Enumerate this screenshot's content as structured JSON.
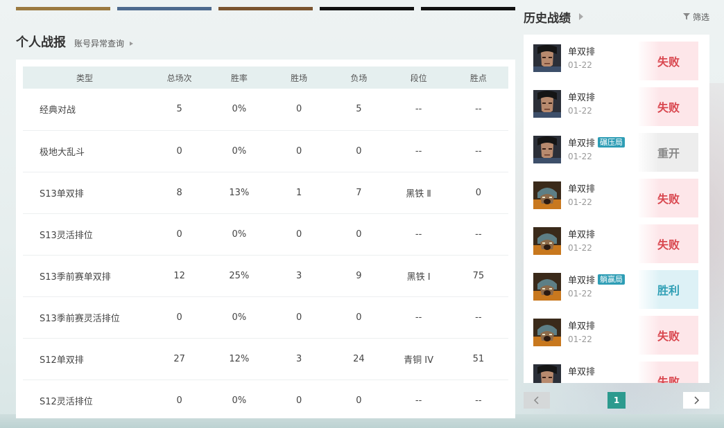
{
  "colors": {
    "strips": [
      "#9b7a40",
      "#4d6a8e",
      "#7a5430",
      "#111111",
      "#111111"
    ],
    "lose": "#d9474f",
    "win": "#2f9fb5",
    "remake": "#888888",
    "page_active": "#2c9a8e"
  },
  "left": {
    "title": "个人战报",
    "account_link": "账号异常查询"
  },
  "table": {
    "headers": {
      "type": "类型",
      "total": "总场次",
      "winrate": "胜率",
      "wins": "胜场",
      "losses": "负场",
      "rank": "段位",
      "lp": "胜点"
    },
    "rows": [
      {
        "type": "经典对战",
        "total": "5",
        "winrate": "0%",
        "wins": "0",
        "losses": "5",
        "rank": "--",
        "lp": "--"
      },
      {
        "type": "极地大乱斗",
        "total": "0",
        "winrate": "0%",
        "wins": "0",
        "losses": "0",
        "rank": "--",
        "lp": "--"
      },
      {
        "type": "S13单双排",
        "total": "8",
        "winrate": "13%",
        "wins": "1",
        "losses": "7",
        "rank": "黑铁 Ⅱ",
        "lp": "0"
      },
      {
        "type": "S13灵活排位",
        "total": "0",
        "winrate": "0%",
        "wins": "0",
        "losses": "0",
        "rank": "--",
        "lp": "--"
      },
      {
        "type": "S13季前赛单双排",
        "total": "12",
        "winrate": "25%",
        "wins": "3",
        "losses": "9",
        "rank": "黑铁 Ⅰ",
        "lp": "75"
      },
      {
        "type": "S13季前赛灵活排位",
        "total": "0",
        "winrate": "0%",
        "wins": "0",
        "losses": "0",
        "rank": "--",
        "lp": "--"
      },
      {
        "type": "S12单双排",
        "total": "27",
        "winrate": "12%",
        "wins": "3",
        "losses": "24",
        "rank": "青铜 IV",
        "lp": "51"
      },
      {
        "type": "S12灵活排位",
        "total": "0",
        "winrate": "0%",
        "wins": "0",
        "losses": "0",
        "rank": "--",
        "lp": "--"
      }
    ]
  },
  "history": {
    "title": "历史战绩",
    "filter_label": "筛选",
    "matches": [
      {
        "mode": "单双排",
        "date": "01-22",
        "tag": "",
        "result": "失败",
        "kind": "lose",
        "champion_icon": "champion-portrait-dark-hair"
      },
      {
        "mode": "单双排",
        "date": "01-22",
        "tag": "",
        "result": "失败",
        "kind": "lose",
        "champion_icon": "champion-portrait-dark-hair"
      },
      {
        "mode": "单双排",
        "date": "01-22",
        "tag": "碾压局",
        "result": "重开",
        "kind": "remake",
        "champion_icon": "champion-portrait-dark-hair"
      },
      {
        "mode": "单双排",
        "date": "01-22",
        "tag": "",
        "result": "失败",
        "kind": "lose",
        "champion_icon": "champion-portrait-horned-helmet"
      },
      {
        "mode": "单双排",
        "date": "01-22",
        "tag": "",
        "result": "失败",
        "kind": "lose",
        "champion_icon": "champion-portrait-horned-helmet"
      },
      {
        "mode": "单双排",
        "date": "01-22",
        "tag": "躺赢局",
        "result": "胜利",
        "kind": "win",
        "champion_icon": "champion-portrait-horned-helmet"
      },
      {
        "mode": "单双排",
        "date": "01-22",
        "tag": "",
        "result": "失败",
        "kind": "lose",
        "champion_icon": "champion-portrait-horned-helmet"
      },
      {
        "mode": "单双排",
        "date": "",
        "tag": "",
        "result": "失败",
        "kind": "lose",
        "champion_icon": "champion-portrait-dark-hair"
      }
    ],
    "pagination": {
      "current": "1"
    }
  }
}
